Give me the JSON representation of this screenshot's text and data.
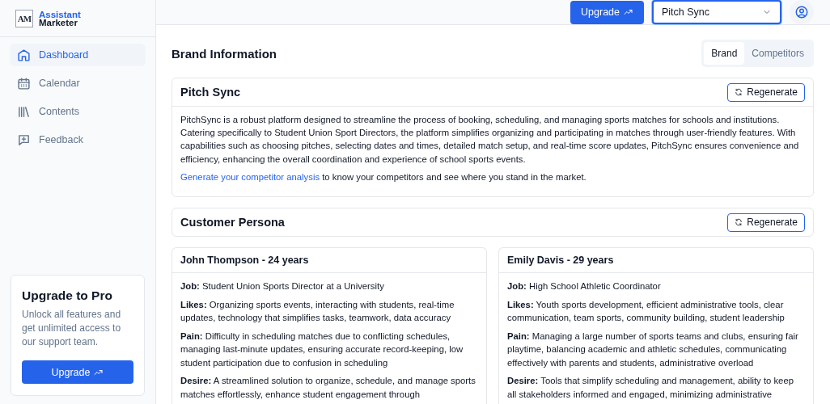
{
  "logo": {
    "mark": "AM",
    "line1": "Assistant",
    "line2": "Marketer"
  },
  "sidebar": {
    "items": [
      {
        "label": "Dashboard",
        "selected": true
      },
      {
        "label": "Calendar",
        "selected": false
      },
      {
        "label": "Contents",
        "selected": false
      },
      {
        "label": "Feedback",
        "selected": false
      }
    ],
    "promo": {
      "title": "Upgrade to Pro",
      "text": "Unlock all features and get unlimited access to our support team.",
      "button": "Upgrade"
    }
  },
  "header": {
    "upgrade_button": "Upgrade",
    "brand_select": {
      "value": "Pitch Sync"
    }
  },
  "page_title": "Brand Information",
  "tabs": [
    {
      "label": "Brand",
      "selected": true
    },
    {
      "label": "Competitors",
      "selected": false
    }
  ],
  "brand_card": {
    "title": "Pitch Sync",
    "button": "Regenerate",
    "description": "PitchSync is a robust platform designed to streamline the process of booking, scheduling, and managing sports matches for schools and institutions. Catering specifically to Student Union Sport Directors, the platform simplifies organizing and participating in matches through user-friendly features. With capabilities such as choosing pitches, selecting dates and times, detailed match setup, and real-time score updates, PitchSync ensures convenience and efficiency, enhancing the overall coordination and experience of school sports events.",
    "link": "Generate your competitor analysis",
    "link_suffix": " to know your competitors and see where you stand in the market."
  },
  "persona_section": {
    "title": "Customer Persona",
    "button": "Regenerate"
  },
  "personas": [
    {
      "name": "John Thompson - 24 years",
      "fields": [
        "**Job:** Student Union Sports Director at a University",
        "**Likes:** Organizing sports events, interacting with students, real-time updates, technology that simplifies tasks, teamwork, data accuracy",
        "**Pain:** Difficulty in scheduling matches due to conflicting schedules, managing last-minute updates, ensuring accurate record-keeping, low student participation due to confusion in scheduling",
        "**Desire:** A streamlined solution to organize, schedule, and manage sports matches effortlessly, enhance student engagement through"
      ]
    },
    {
      "name": "Emily Davis - 29 years",
      "fields": [
        "**Job:** High School Athletic Coordinator",
        "**Likes:** Youth sports development, efficient administrative tools, clear communication, team sports, community building, student leadership",
        "**Pain:** Managing a large number of sports teams and clubs, ensuring fair playtime, balancing academic and athletic schedules, communicating effectively with parents and students, administrative overload",
        "**Desire:** Tools that simplify scheduling and management, ability to keep all stakeholders informed and engaged, minimizing administrative"
      ]
    }
  ]
}
